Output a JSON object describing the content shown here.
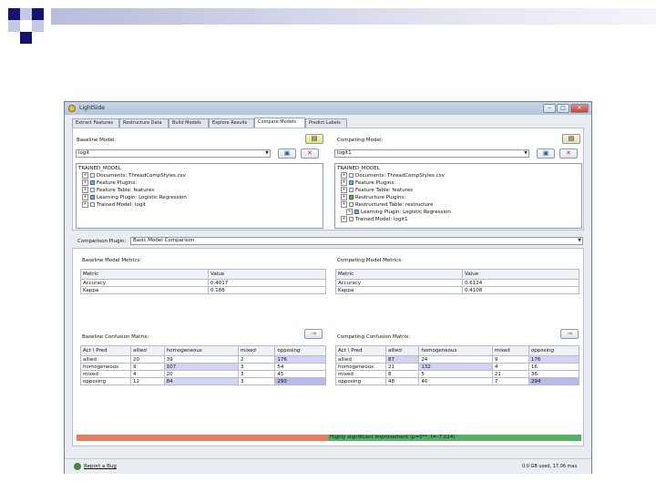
{
  "window": {
    "title": "LightSide",
    "controls": {
      "minimize": "–",
      "maximize": "□",
      "close": "✕"
    }
  },
  "tabs": [
    "Extract Features",
    "Restructure Data",
    "Build Models",
    "Explore Results",
    "Compare Models",
    "Predict Labels"
  ],
  "active_tab": "Compare Models",
  "baseline": {
    "label": "Baseline Model:",
    "selected": "logit",
    "tree": [
      "TRAINED_MODEL",
      "Documents: ThreadCompStyles.csv",
      "Feature Plugins:",
      "Feature Table: features",
      "Learning Plugin: Logistic Regression",
      "Trained Model: logit"
    ]
  },
  "competing": {
    "label": "Competing Model:",
    "selected": "logit1",
    "tree": [
      "TRAINED_MODEL",
      "Documents: ThreadCompStyles.csv",
      "Feature Plugins:",
      "Feature Table: features",
      "Restructure Plugins:",
      "Restructured Table: restructure",
      "Learning Plugin: Logistic Regression",
      "Trained Model: logit1"
    ]
  },
  "comparison": {
    "label": "Comparison Plugin:",
    "selected": "Basic Model Comparison"
  },
  "baseline_metrics": {
    "title": "Baseline Model Metrics:",
    "columns": [
      "Metric",
      "Value"
    ],
    "rows": [
      [
        "Accuracy",
        "0.4017"
      ],
      [
        "Kappa",
        "0.188"
      ]
    ]
  },
  "competing_metrics": {
    "title": "Competing Model Metrics:",
    "columns": [
      "Metric",
      "Value"
    ],
    "rows": [
      [
        "Accuracy",
        "0.6124"
      ],
      [
        "Kappa",
        "0.4108"
      ]
    ]
  },
  "baseline_matrix": {
    "title": "Baseline Confusion Matrix:",
    "columns": [
      "Act \\ Pred",
      "allied",
      "homogeneous",
      "mixed",
      "opposing"
    ],
    "rows": [
      [
        "allied",
        "20",
        "39",
        "2",
        "176"
      ],
      [
        "homogeneous",
        "9",
        "107",
        "3",
        "54"
      ],
      [
        "mixed",
        "4",
        "20",
        "3",
        "45"
      ],
      [
        "opposing",
        "12",
        "84",
        "3",
        "290"
      ]
    ]
  },
  "competing_matrix": {
    "title": "Competing Confusion Matrix:",
    "columns": [
      "Act \\ Pred",
      "allied",
      "homogeneous",
      "mixed",
      "opposing"
    ],
    "rows": [
      [
        "allied",
        "87",
        "24",
        "9",
        "176"
      ],
      [
        "homogeneous",
        "21",
        "132",
        "4",
        "16"
      ],
      [
        "mixed",
        "8",
        "5",
        "21",
        "36"
      ],
      [
        "opposing",
        "48",
        "40",
        "7",
        "294"
      ]
    ]
  },
  "significance": "Highly significant improvement (p=0**, t=-7.024)",
  "status": {
    "bug": "Report a Bug",
    "memory": "0.0 GB used, 17.06 max"
  },
  "colors": {
    "worse": "#ea7a5b",
    "better": "#54b263",
    "highlight": "#b9b9ee"
  }
}
